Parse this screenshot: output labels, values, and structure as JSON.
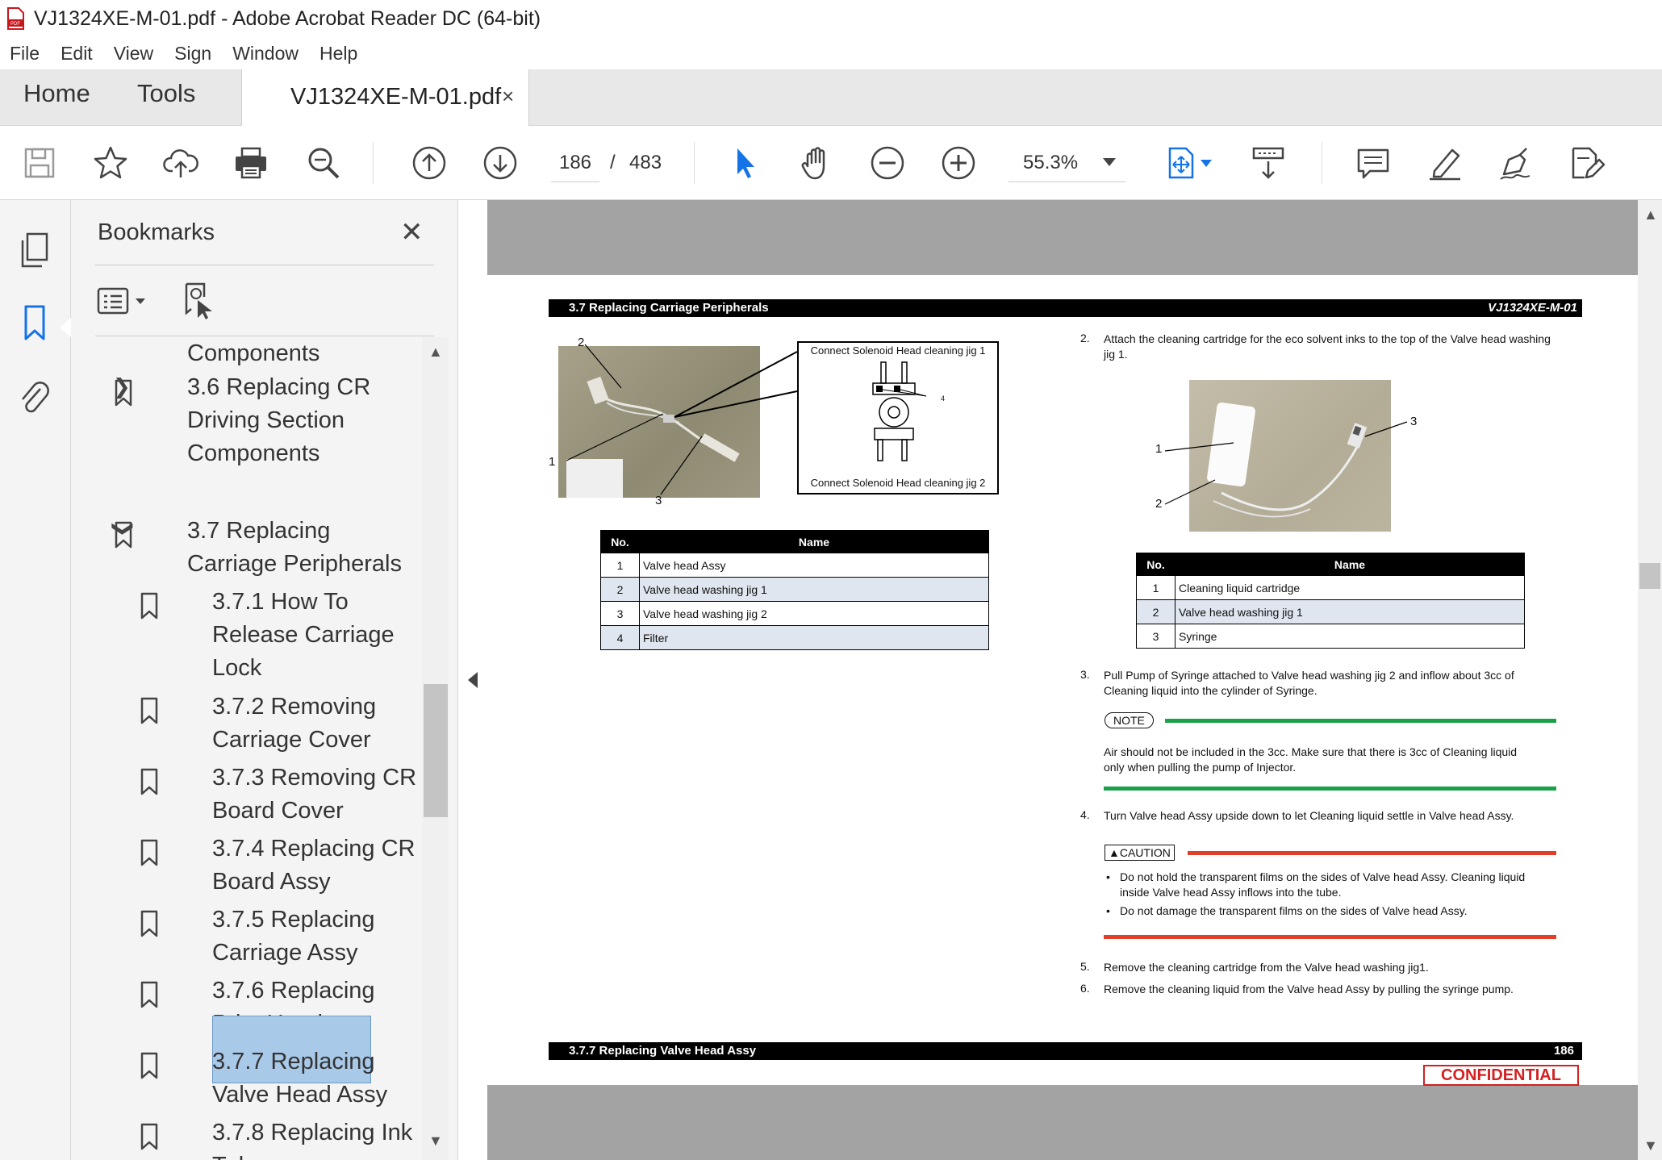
{
  "window": {
    "title": "VJ1324XE-M-01.pdf - Adobe Acrobat Reader DC (64-bit)"
  },
  "menu": [
    "File",
    "Edit",
    "View",
    "Sign",
    "Window",
    "Help"
  ],
  "tabs": {
    "home": "Home",
    "tools": "Tools",
    "document": "VJ1324XE-M-01.pdf",
    "close": "×"
  },
  "toolbar": {
    "current_page": "186",
    "page_separator": "/",
    "total_pages": "483",
    "zoom": "55.3%"
  },
  "bookmarks": {
    "title": "Bookmarks",
    "close": "✕",
    "items": [
      {
        "label_lines": [
          "Components"
        ]
      },
      {
        "label_lines": [
          "3.6 Replacing CR",
          "Driving Section",
          "Components"
        ]
      },
      {
        "label_lines": [
          "3.7 Replacing",
          "Carriage Peripherals"
        ]
      },
      {
        "label_lines": [
          "3.7.1 How To",
          "Release Carriage",
          "Lock"
        ]
      },
      {
        "label_lines": [
          "3.7.2 Removing",
          "Carriage Cover"
        ]
      },
      {
        "label_lines": [
          "3.7.3 Removing CR",
          "Board Cover"
        ]
      },
      {
        "label_lines": [
          "3.7.4 Replacing CR",
          "Board Assy"
        ]
      },
      {
        "label_lines": [
          "3.7.5 Replacing",
          "Carriage Assy"
        ]
      },
      {
        "label_lines": [
          "3.7.6 Replacing",
          "Print Head"
        ]
      },
      {
        "label_lines": [
          "3.7.7 Replacing",
          "Valve Head Assy"
        ]
      },
      {
        "label_lines": [
          "3.7.8 Replacing Ink",
          "Tube"
        ]
      }
    ]
  },
  "pdf_page": {
    "header_left": "3.7 Replacing Carriage Peripherals",
    "header_right": "VJ1324XE-M-01",
    "footer_left": "3.7.7 Replacing Valve Head Assy",
    "footer_right": "186",
    "confidential": "CONFIDENTIAL",
    "figure1": {
      "callout_top": "Connect Solenoid Head cleaning jig 1",
      "callout_bottom": "Connect Solenoid Head cleaning jig 2",
      "labels": [
        "1",
        "2",
        "3",
        "4"
      ]
    },
    "table1": {
      "headers": [
        "No.",
        "Name"
      ],
      "rows": [
        [
          "1",
          "Valve head Assy"
        ],
        [
          "2",
          "Valve head washing jig 1"
        ],
        [
          "3",
          "Valve head washing jig 2"
        ],
        [
          "4",
          "Filter"
        ]
      ]
    },
    "figure2": {
      "labels": [
        "1",
        "2",
        "3"
      ]
    },
    "table2": {
      "headers": [
        "No.",
        "Name"
      ],
      "rows": [
        [
          "1",
          "Cleaning liquid cartridge"
        ],
        [
          "2",
          "Valve head washing jig 1"
        ],
        [
          "3",
          "Syringe"
        ]
      ]
    },
    "steps": {
      "s2_num": "2.",
      "s2_line1": "Attach the cleaning cartridge for the eco solvent inks to the top of the Valve head washing",
      "s2_line2": "jig 1.",
      "s3_num": "3.",
      "s3_line1": "Pull Pump of Syringe attached to Valve head washing jig 2 and inflow about 3cc of",
      "s3_line2": "Cleaning liquid into the cylinder of Syringe.",
      "note_tag": "NOTE",
      "note_line1": "Air should not be included in the 3cc. Make sure that there is 3cc of Cleaning liquid",
      "note_line2": "only when pulling the pump of Injector.",
      "s4_num": "4.",
      "s4_line1": "Turn Valve head Assy upside down to let Cleaning liquid settle in Valve head Assy.",
      "caution_tag": "CAUTION",
      "caution_b1_line1": "Do not hold the transparent films on the sides of Valve head Assy. Cleaning liquid",
      "caution_b1_line2": "inside Valve head Assy inflows into the tube.",
      "caution_b2": "Do not damage the transparent films on the sides of Valve head Assy.",
      "s5_num": "5.",
      "s5_line1": "Remove the cleaning cartridge from the Valve head washing jig1.",
      "s6_num": "6.",
      "s6_line1": "Remove the cleaning liquid from the Valve head Assy by pulling the syringe pump."
    }
  },
  "colors": {
    "accent_blue": "#1473e6",
    "selected_bookmark": "#a9c9e8",
    "note_green": "#1aa14a",
    "caution_red": "#e0402a",
    "confidential_red": "#d42020"
  },
  "icons": [
    "save-icon",
    "star-icon",
    "upload-icon",
    "print-icon",
    "search-zoom-icon",
    "page-up-icon",
    "page-down-icon",
    "select-cursor-icon",
    "hand-icon",
    "zoom-out-icon",
    "zoom-in-icon",
    "fit-page-icon",
    "scroll-mode-icon",
    "comment-icon",
    "highlight-icon",
    "sign-icon",
    "edit-icon"
  ]
}
